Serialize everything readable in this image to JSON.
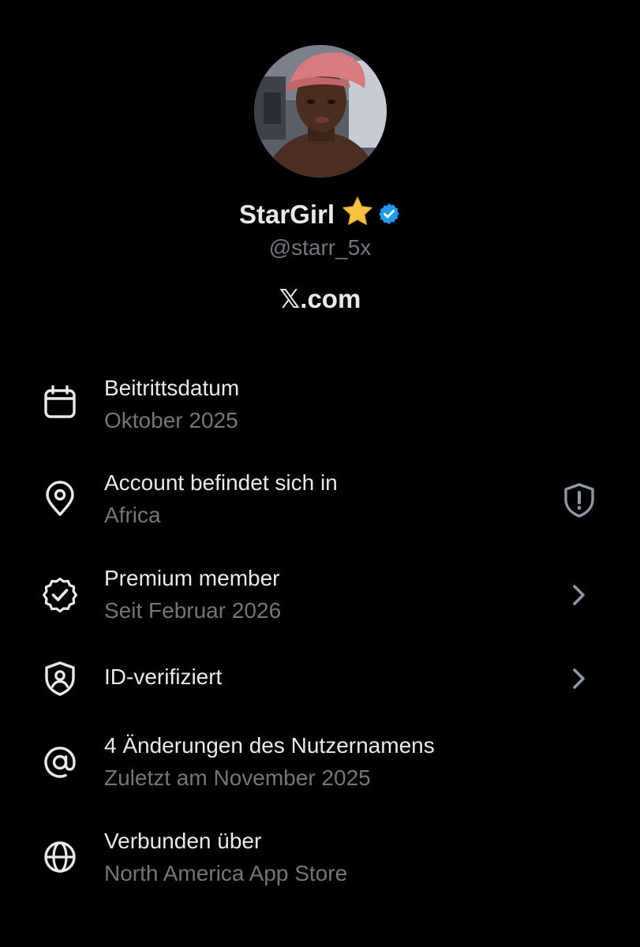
{
  "profile": {
    "display_name": "StarGirl",
    "handle": "@starr_5x",
    "site": "𝕏.com",
    "name_emoji": "star-emoji",
    "verified_badge_color": "#1d9bf0"
  },
  "rows": [
    {
      "icon": "calendar-icon",
      "title": "Beitrittsdatum",
      "subtitle": "Oktober 2025"
    },
    {
      "icon": "location-pin-icon",
      "title": "Account befindet sich in",
      "subtitle": "Africa",
      "right_icon": "shield-alert-icon"
    },
    {
      "icon": "verified-badge-outline-icon",
      "title": "Premium member",
      "subtitle": "Seit Februar 2026",
      "right_icon": "chevron-right-icon"
    },
    {
      "icon": "id-shield-icon",
      "title": "ID-verifiziert",
      "right_icon": "chevron-right-icon"
    },
    {
      "icon": "at-sign-icon",
      "title": "4 Änderungen des Nutzernamens",
      "subtitle": "Zuletzt am November 2025"
    },
    {
      "icon": "globe-icon",
      "title": "Verbunden über",
      "subtitle": "North America App Store"
    }
  ],
  "colors": {
    "background": "#000000",
    "primary_text": "#e7e9ea",
    "secondary_text": "#71767b",
    "verified_blue": "#1d9bf0"
  }
}
